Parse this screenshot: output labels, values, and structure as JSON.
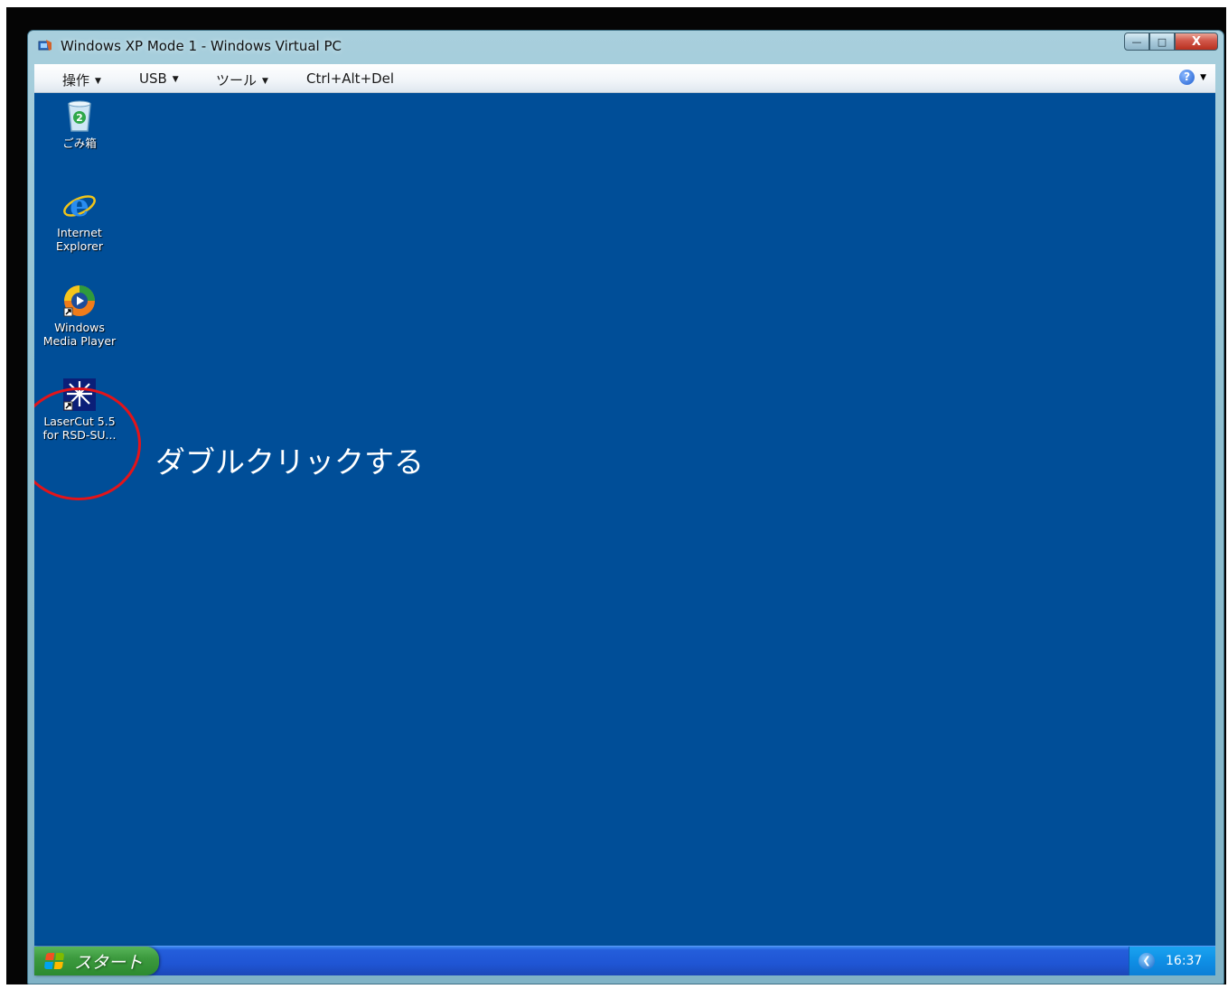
{
  "window": {
    "title": "Windows XP Mode 1 - Windows Virtual PC",
    "caption_buttons": {
      "minimize": "—",
      "maximize": "□",
      "close": "X"
    }
  },
  "toolbar": {
    "menus": [
      {
        "label": "操作"
      },
      {
        "label": "USB"
      },
      {
        "label": "ツール"
      }
    ],
    "ctrl_alt_del_label": "Ctrl+Alt+Del",
    "help_label": "?"
  },
  "desktop": {
    "background_color": "#004e98",
    "icons": [
      {
        "name": "recycle-bin",
        "label": "ごみ箱"
      },
      {
        "name": "internet-explorer",
        "label": "Internet\nExplorer"
      },
      {
        "name": "windows-media-player",
        "label": "Windows\nMedia Player"
      },
      {
        "name": "lasercut",
        "label": "LaserCut 5.5\nfor RSD-SU..."
      }
    ],
    "annotation": {
      "text": "ダブルクリックする",
      "circle_color": "#e3141a"
    }
  },
  "taskbar": {
    "start_label": "スタート",
    "clock": "16:37"
  }
}
